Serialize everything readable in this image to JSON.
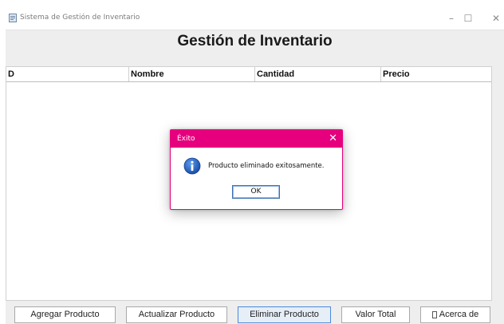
{
  "window": {
    "title": "Sistema de Gestión de Inventario",
    "minimize": "–",
    "maximize": "☐",
    "close": "✕"
  },
  "heading": "Gestión de Inventario",
  "table": {
    "columns": [
      "D",
      "Nombre",
      "Cantidad",
      "Precio"
    ],
    "rows": []
  },
  "buttons": {
    "add": "Agregar Producto",
    "update": "Actualizar Producto",
    "delete": "Eliminar Producto",
    "total": "Valor Total",
    "about": "Acerca de"
  },
  "dialog": {
    "title": "Éxito",
    "close": "✕",
    "message": "Producto eliminado exitosamente.",
    "ok": "OK"
  },
  "colors": {
    "dialog_accent": "#e6007e",
    "focus": "#4a8ad8",
    "info_icon": "#1f63c6"
  },
  "icons": {
    "app": "app-window-icon",
    "info": "info-icon",
    "about": "document-icon"
  }
}
